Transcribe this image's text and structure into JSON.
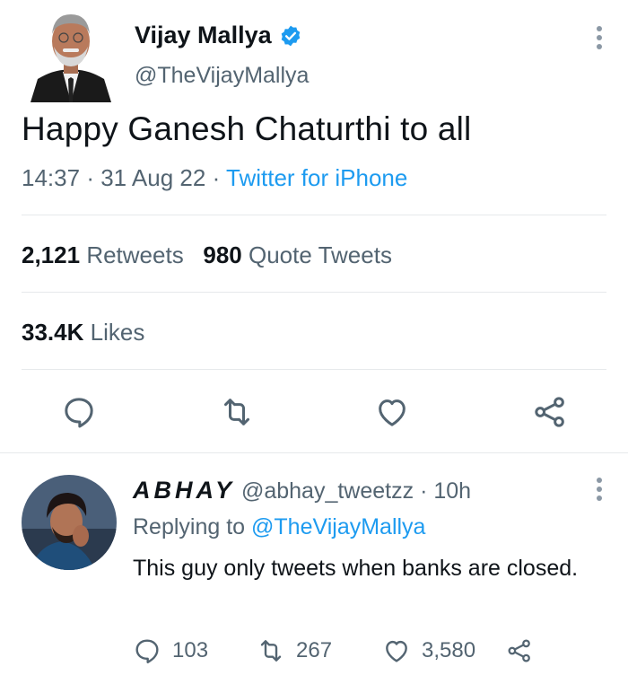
{
  "tweet": {
    "author_name": "Vijay Mallya",
    "handle": "@TheVijayMallya",
    "text": "Happy Ganesh Chaturthi to all",
    "time": "14:37",
    "date": "31 Aug 22",
    "separator": "·",
    "source": "Twitter for iPhone",
    "retweets_count": "2,121",
    "retweets_label": "Retweets",
    "quote_count": "980",
    "quote_label": "Quote Tweets",
    "likes_count": "33.4K",
    "likes_label": "Likes",
    "icons": [
      "reply-icon",
      "retweet-icon",
      "like-icon",
      "share-icon"
    ],
    "verified_color": "#1d9bf0"
  },
  "reply": {
    "author_name": "ABHAY",
    "handle": "@abhay_tweetzz",
    "separator": "·",
    "age": "10h",
    "replying_prefix": "Replying to",
    "replying_to": "@TheVijayMallya",
    "text": "This guy only tweets when banks are closed.",
    "reply_count": "103",
    "retweet_count": "267",
    "like_count": "3,580"
  },
  "colors": {
    "accent": "#1d9bf0",
    "text_primary": "#0f1419",
    "text_secondary": "#536471",
    "divider": "#e6e9eb"
  }
}
